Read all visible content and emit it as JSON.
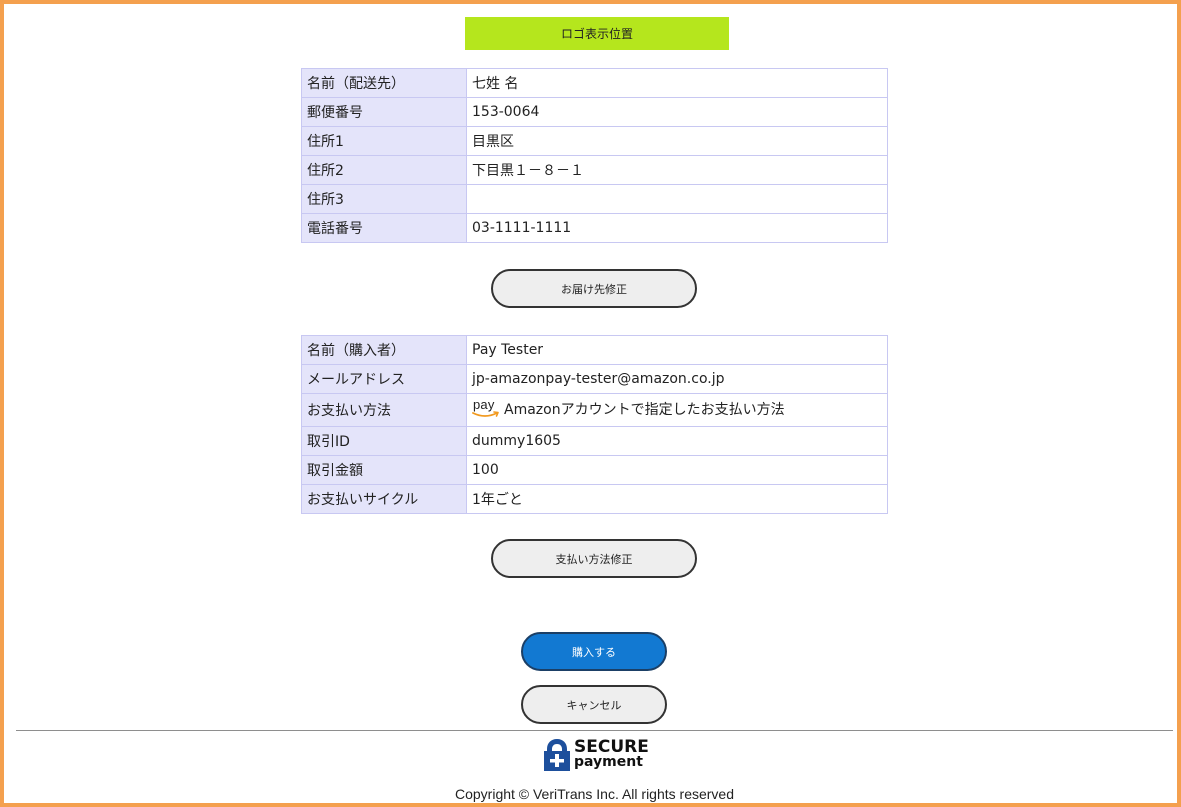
{
  "logo_area": {
    "label": "ロゴ表示位置",
    "background": "#b5e61d"
  },
  "shipping": {
    "rows": [
      {
        "label": "名前（配送先）",
        "value": "七姓 名"
      },
      {
        "label": "郵便番号",
        "value": "153-0064"
      },
      {
        "label": "住所1",
        "value": "目黒区"
      },
      {
        "label": "住所2",
        "value": "下目黒１－８－１"
      },
      {
        "label": "住所3",
        "value": ""
      },
      {
        "label": "電話番号",
        "value": "03-1111-1111"
      }
    ],
    "edit_button": "お届け先修正"
  },
  "purchase": {
    "name_label": "名前（購入者）",
    "name_value": "Pay Tester",
    "email_label": "メールアドレス",
    "email_value": "jp-amazonpay-tester@amazon.co.jp",
    "payment_label": "お支払い方法",
    "payment_logo_text": "pay",
    "payment_value": "Amazonアカウントで指定したお支払い方法",
    "txn_id_label": "取引ID",
    "txn_id_value": "dummy1605",
    "amount_label": "取引金額",
    "amount_value": "100",
    "cycle_label": "お支払いサイクル",
    "cycle_value": "1年ごと",
    "edit_button": "支払い方法修正"
  },
  "actions": {
    "buy_button": "購入する",
    "cancel_button": "キャンセル"
  },
  "footer": {
    "logo_line1": "SECURE",
    "logo_line2": "payment",
    "copyright": "Copyright © VeriTrans Inc. All rights reserved"
  },
  "colors": {
    "frame_border": "#f4a04e",
    "label_cell": "#e4e4fa",
    "primary_button": "#1279d2",
    "amazon_smile": "#f29a1f"
  }
}
